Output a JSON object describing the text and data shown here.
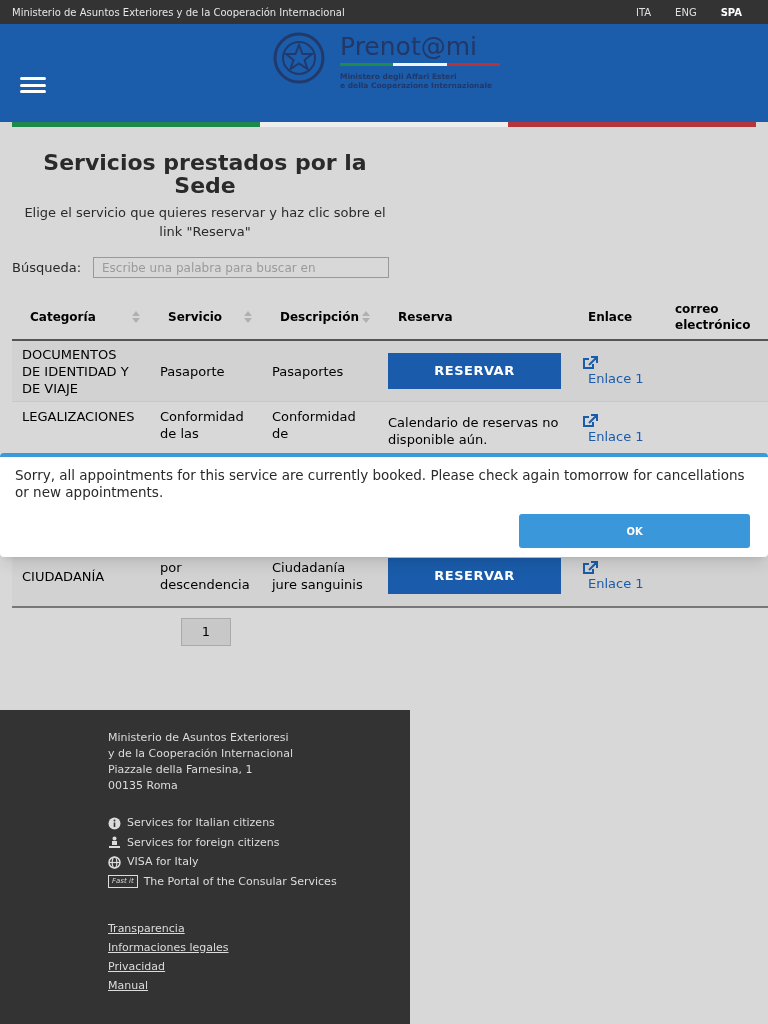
{
  "top_bar": {
    "ministry": "Ministerio de Asuntos Exteriores y de la Cooperación Internacional",
    "languages": [
      {
        "label": "ITA",
        "selected": false
      },
      {
        "label": "ENG",
        "selected": false
      },
      {
        "label": "SPA",
        "selected": true
      }
    ]
  },
  "header": {
    "logo_title": "Prenot@mi",
    "logo_subtitle": [
      "Ministero degli Affari Esteri",
      "e della Cooperazione Internazionale"
    ]
  },
  "page": {
    "title": "Servicios prestados por la Sede",
    "intro": "Elige el servicio que quieres reservar y haz clic sobre el link \"Reserva\"",
    "search": {
      "label": "Búsqueda:",
      "placeholder": "Escribe una palabra para buscar en"
    }
  },
  "table": {
    "columns": [
      {
        "label": "Categoría",
        "sortable": true
      },
      {
        "label": "Servicio",
        "sortable": true
      },
      {
        "label": "Descripción",
        "sortable": true
      },
      {
        "label": "Reserva",
        "sortable": false
      },
      {
        "label": "Enlace",
        "sortable": false
      },
      {
        "label": "correo electrónico",
        "sortable": false
      }
    ],
    "rows": [
      {
        "category": "DOCUMENTOS DE IDENTIDAD Y DE VIAJE",
        "service": "Pasaporte",
        "description": "Pasaportes",
        "booking": {
          "kind": "button",
          "text": "RESERVAR"
        },
        "link": "Enlace 1"
      },
      {
        "category": "LEGALIZACIONES",
        "service": "Conformidad de las",
        "description": "Conformidad de",
        "booking": {
          "kind": "text",
          "text": "Calendario de reservas no disponible aún."
        },
        "link": "Enlace 1"
      },
      {
        "category": "CIUDADANÍA",
        "service": "por descendencia",
        "description": "Ciudadanía jure sanguinis",
        "booking": {
          "kind": "button",
          "text": "RESERVAR"
        },
        "link": "Enlace 1"
      }
    ]
  },
  "pagination": [
    {
      "label": "1",
      "selected": true
    }
  ],
  "dialog": {
    "message": "Sorry, all appointments for this service are currently booked. Please check again tomorrow for cancellations or new appointments.",
    "button": "OK"
  },
  "footer": {
    "address": [
      "Ministerio de Asuntos Exterioresi",
      "y de la Cooperación Internacional",
      "Piazzale della Farnesina, 1",
      "00135 Roma"
    ],
    "services": [
      {
        "kind": "info",
        "text": "Services for Italian citizens"
      },
      {
        "kind": "person",
        "text": "Services for foreign citizens"
      },
      {
        "kind": "globe",
        "text": "VISA for Italy"
      },
      {
        "kind": "badge",
        "badge": "Fast it",
        "text": "The Portal of the Consular Services"
      }
    ],
    "links": [
      "Transparencia",
      "Informaciones legales",
      "Privacidad",
      "Manual"
    ]
  }
}
